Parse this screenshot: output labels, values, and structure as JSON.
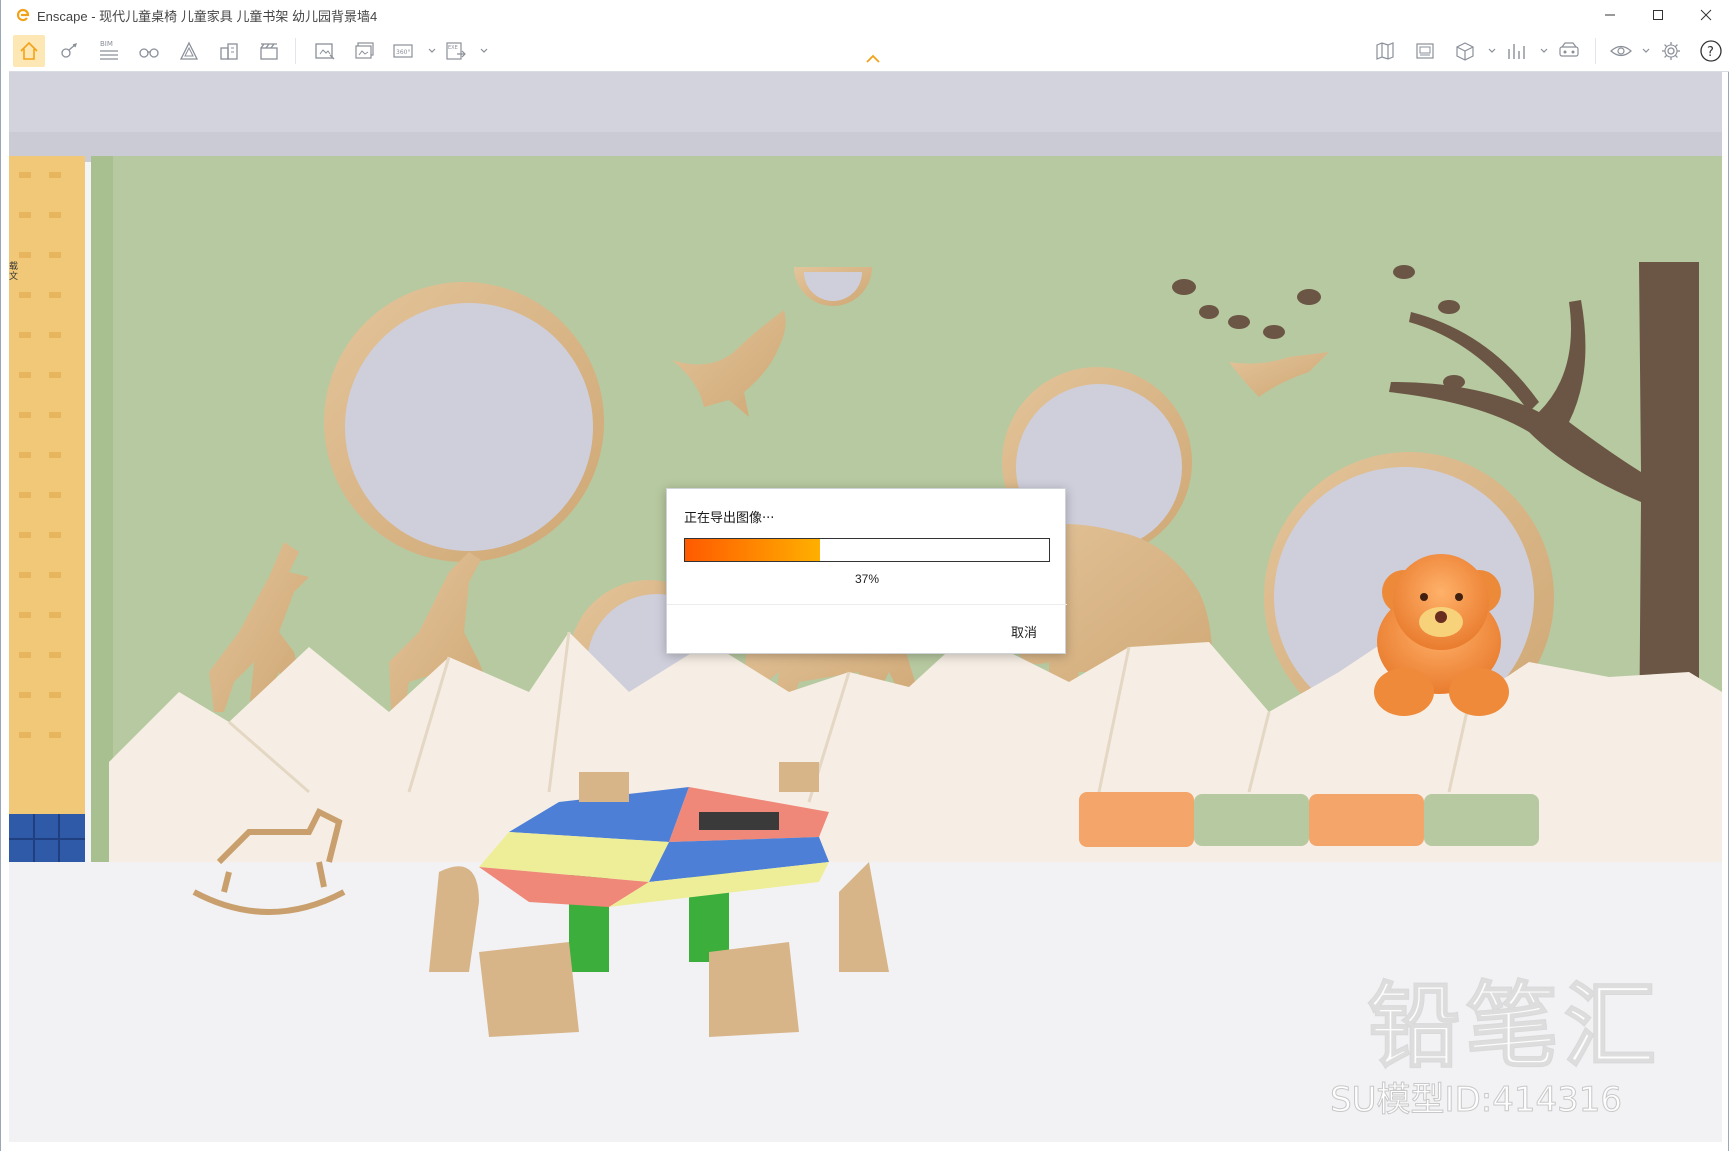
{
  "window": {
    "title": "Enscape - 现代儿童桌椅 儿童家具 儿童书架 幼儿园背景墙4",
    "accent_color": "#f2a218"
  },
  "toolbar": {
    "left_icons": [
      "home-icon",
      "eye-pan-icon",
      "bim-icon",
      "binoculars-icon",
      "perspective-icon",
      "building-icon",
      "clapper-icon",
      "screenshot-icon",
      "batch-render-icon",
      "panorama-icon",
      "exe-export-icon"
    ],
    "bim_label": "BIM",
    "panorama_label": "360°",
    "exe_label": "EXE",
    "right_icons": [
      "map-icon",
      "gallery-icon",
      "asset-cube-icon",
      "stats-icon",
      "vr-headset-icon",
      "view-eye-icon",
      "settings-gear-icon",
      "help-icon"
    ],
    "help_label": "?"
  },
  "sidebar": {
    "stub_chars": [
      "载",
      "文"
    ]
  },
  "dialog": {
    "title": "正在导出图像···",
    "progress_percent": 37,
    "progress_text": "37%",
    "cancel_label": "取消",
    "bar_color_start": "#ff5a00",
    "bar_color_end": "#ffb000"
  },
  "watermark": {
    "brand": "铅笔汇",
    "model_id": "SU模型ID:414316"
  }
}
